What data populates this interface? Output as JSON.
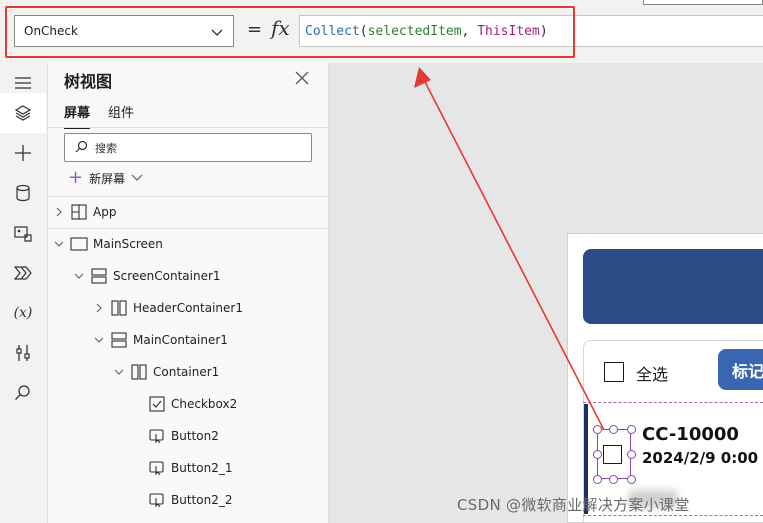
{
  "formula_bar": {
    "property": "OnCheck",
    "equals": "=",
    "fx": "fx",
    "formula": {
      "fn": "Collect",
      "open": "(",
      "arg1": "selectedItem",
      "sep": ", ",
      "arg2": "ThisItem",
      "close": ")"
    }
  },
  "tree_panel": {
    "title": "树视图",
    "tabs": {
      "screens": "屏幕",
      "components": "组件"
    },
    "search_placeholder": "搜索",
    "new_screen": "新屏幕",
    "nodes": {
      "app": "App",
      "main_screen": "MainScreen",
      "screen_container": "ScreenContainer1",
      "header_container": "HeaderContainer1",
      "main_container": "MainContainer1",
      "container": "Container1",
      "checkbox": "Checkbox2",
      "button2": "Button2",
      "button2_1": "Button2_1",
      "button2_2": "Button2_2"
    }
  },
  "canvas": {
    "select_all": "全选",
    "mark_button": "标记",
    "row_code": "CC-10000",
    "row_date": "2024/2/9 0:00"
  },
  "watermark": "CSDN @微软商业解决方案小课堂",
  "colors": {
    "annotation_red": "#e53935",
    "header_blue": "#2b4a86",
    "button_blue": "#3a65b0",
    "selection_purple": "#8d47a8"
  }
}
